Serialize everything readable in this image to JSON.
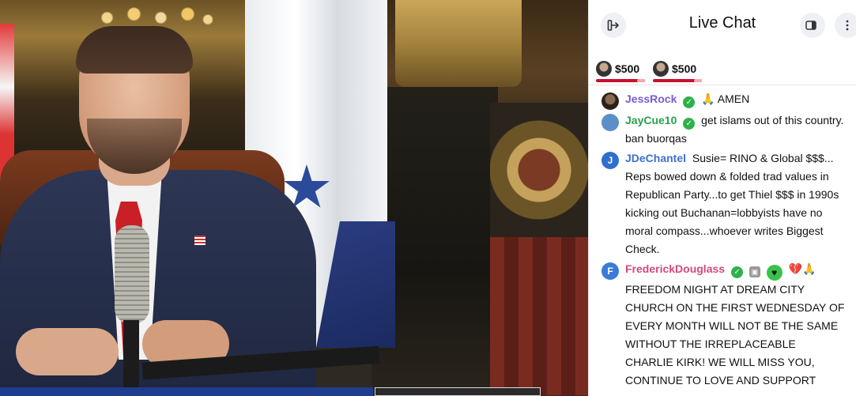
{
  "chat": {
    "title": "Live Chat",
    "tips": [
      {
        "amount": "$500"
      },
      {
        "amount": "$500"
      }
    ],
    "messages": [
      {
        "user": "JessRock",
        "emoji": "🙏",
        "text": "AMEN"
      },
      {
        "user": "JayCue10",
        "text": "get islams out of this country. ban buorqas"
      },
      {
        "user": "JDeChantel",
        "avatar_letter": "J",
        "text": "Susie= RINO & Global $$$... Reps bowed down & folded trad values in Republican Party...to get Thiel $$$ in 1990s kicking out Buchanan=lobbyists have no moral compass...whoever writes Biggest Check."
      },
      {
        "user": "FrederickDouglass",
        "avatar_letter": "F",
        "emoji": "💔🙏",
        "text": "FREEDOM NIGHT AT DREAM CITY CHURCH ON THE FIRST WEDNESDAY OF EVERY MONTH WILL NOT BE THE SAME WITHOUT THE IRREPLACEABLE CHARLIE KIRK! WE WILL MISS YOU, CONTINUE TO LOVE AND SUPPORT"
      }
    ]
  },
  "icons": {
    "exit": "exit-icon",
    "video": "video-toggle-icon",
    "more": "more-vertical-icon",
    "verified": "verified-badge-icon"
  },
  "colors": {
    "tip_bar": "#c8102e",
    "user_jessrock": "#7a5bd0",
    "user_jaycue10": "#27a14a",
    "user_jdechantel": "#3f6fd1",
    "user_frederickdouglass": "#d04a7d"
  }
}
